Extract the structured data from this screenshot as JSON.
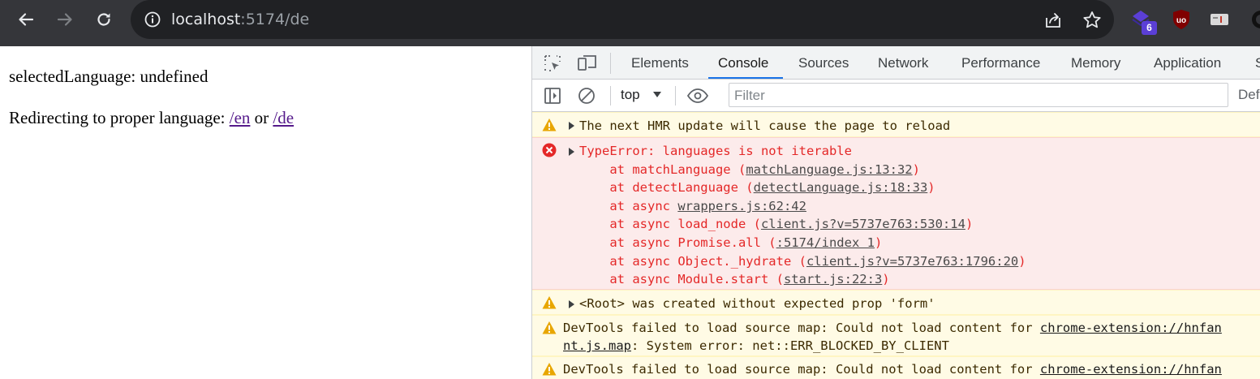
{
  "browser": {
    "url_host": "localhost",
    "url_rest": ":5174/de",
    "extension_badge": "6"
  },
  "page": {
    "line1": "selectedLanguage: undefined",
    "line2_prefix": "Redirecting to proper language: ",
    "link_en": "/en",
    "link_or": " or ",
    "link_de": "/de"
  },
  "devtools": {
    "tabs": [
      "Elements",
      "Console",
      "Sources",
      "Network",
      "Performance",
      "Memory",
      "Application",
      "S"
    ],
    "active_tab": "Console",
    "context": "top",
    "filter_placeholder": "Filter",
    "default_levels": "Def"
  },
  "console": {
    "messages": [
      {
        "level": "warning",
        "text": "The next HMR update will cause the page to reload"
      },
      {
        "level": "error",
        "text": "TypeError: languages is not iterable",
        "stack": [
          {
            "prefix": "    at matchLanguage (",
            "link": "matchLanguage.js:13:32",
            "suffix": ")"
          },
          {
            "prefix": "    at detectLanguage (",
            "link": "detectLanguage.js:18:33",
            "suffix": ")"
          },
          {
            "prefix": "    at async ",
            "link": "wrappers.js:62:42",
            "suffix": ""
          },
          {
            "prefix": "    at async load_node (",
            "link": "client.js?v=5737e763:530:14",
            "suffix": ")"
          },
          {
            "prefix": "    at async Promise.all (",
            "link": ":5174/index 1",
            "suffix": ")"
          },
          {
            "prefix": "    at async Object._hydrate (",
            "link": "client.js?v=5737e763:1796:20",
            "suffix": ")"
          },
          {
            "prefix": "    at async Module.start (",
            "link": "start.js:22:3",
            "suffix": ")"
          }
        ]
      },
      {
        "level": "warning",
        "text": "<Root> was created without expected prop 'form'"
      },
      {
        "level": "warning",
        "prefix": "DevTools failed to load source map: Could not load content for ",
        "link": "chrome-extension://hnfan",
        "line2_link": "nt.js.map",
        "line2_suffix": ": System error: net::ERR_BLOCKED_BY_CLIENT"
      },
      {
        "level": "warning",
        "prefix": "DevTools failed to load source map: Could not load content for ",
        "link": "chrome-extension://hnfan"
      }
    ]
  },
  "colors": {
    "toolbar_bg": "#35363a",
    "omnibox_bg": "#202124",
    "warning_bg": "#fffbe5",
    "error_bg": "#fcebeb",
    "error_text": "#e42828",
    "link_visited": "#551a8b",
    "tab_underline": "#1a73e8"
  }
}
